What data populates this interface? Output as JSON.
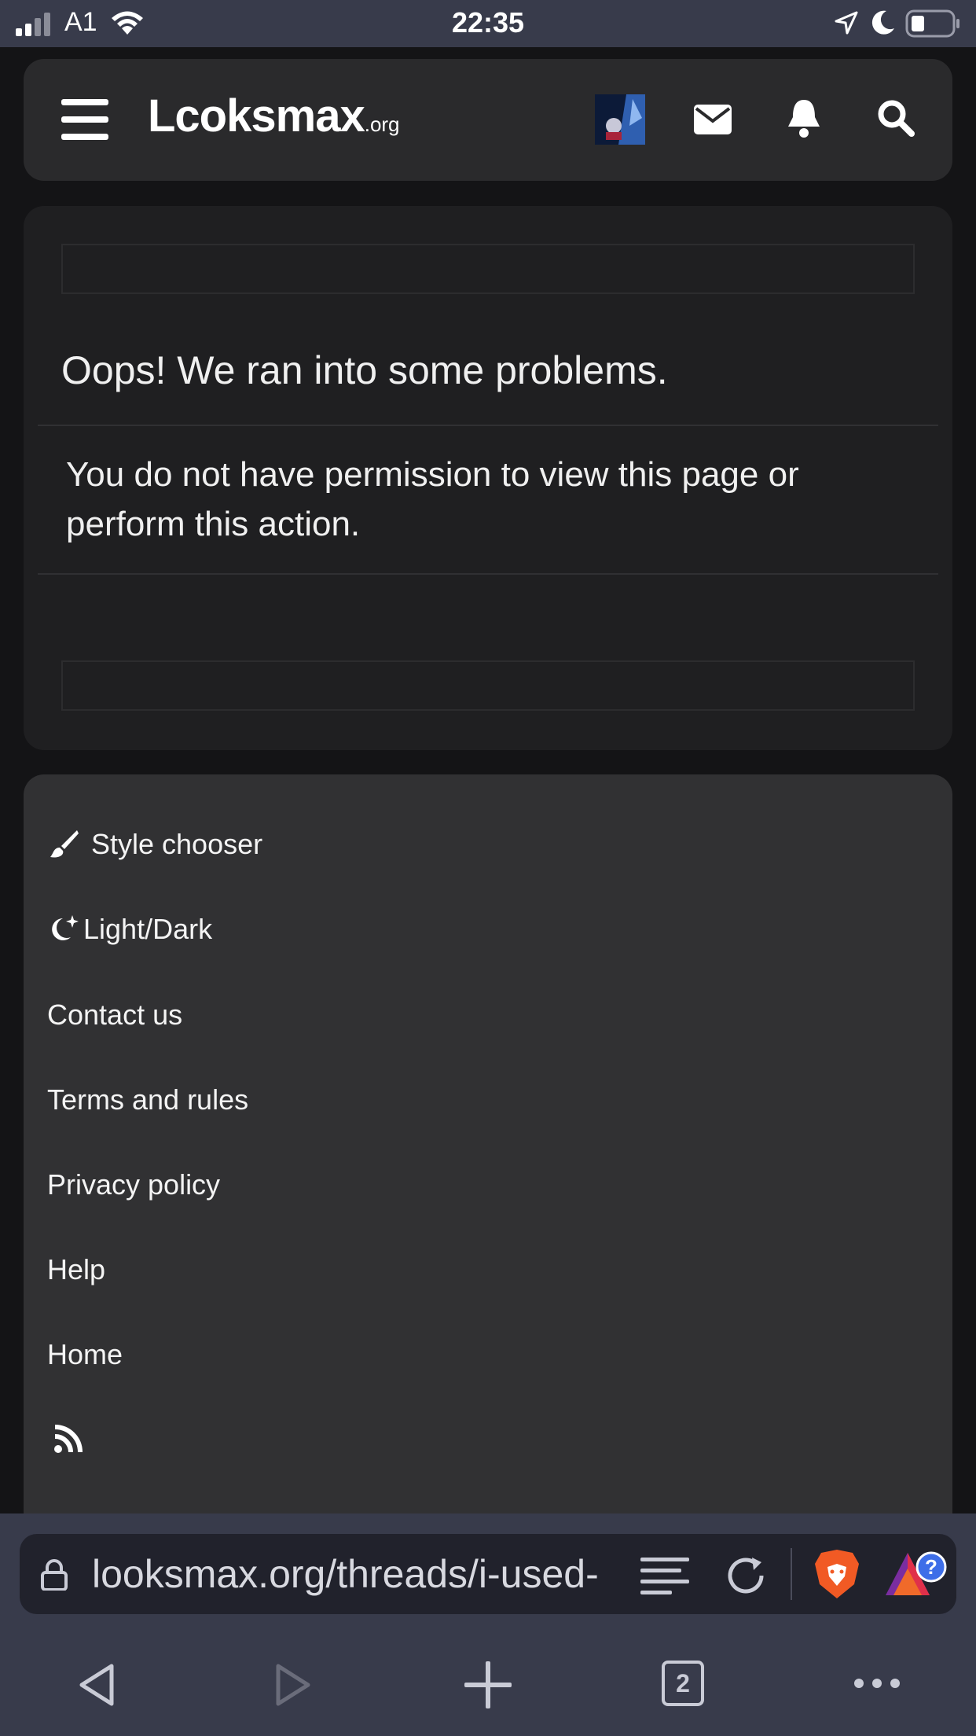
{
  "status_bar": {
    "carrier": "A1",
    "time": "22:35"
  },
  "header": {
    "logo_main": "Lcoksmax",
    "logo_tld": ".org",
    "icons": [
      "menu-icon",
      "avatar",
      "envelope-icon",
      "bell-icon",
      "search-icon"
    ]
  },
  "error": {
    "title": "Oops! We ran into some problems.",
    "message": "You do not have permission to view this page or perform this action."
  },
  "footer": {
    "items": [
      {
        "label": "Style chooser",
        "icon": "paintbrush-icon"
      },
      {
        "label": "Light/Dark",
        "icon": "moon-stars-icon"
      },
      {
        "label": "Contact us"
      },
      {
        "label": "Terms and rules"
      },
      {
        "label": "Privacy policy"
      },
      {
        "label": "Help"
      },
      {
        "label": "Home"
      }
    ],
    "rss_icon": "rss-icon"
  },
  "browser": {
    "url": "looksmax.org/threads/i-used-",
    "tabs_count": "2",
    "colors": {
      "brave": "#f15a24",
      "bar": "#383b4b"
    }
  }
}
